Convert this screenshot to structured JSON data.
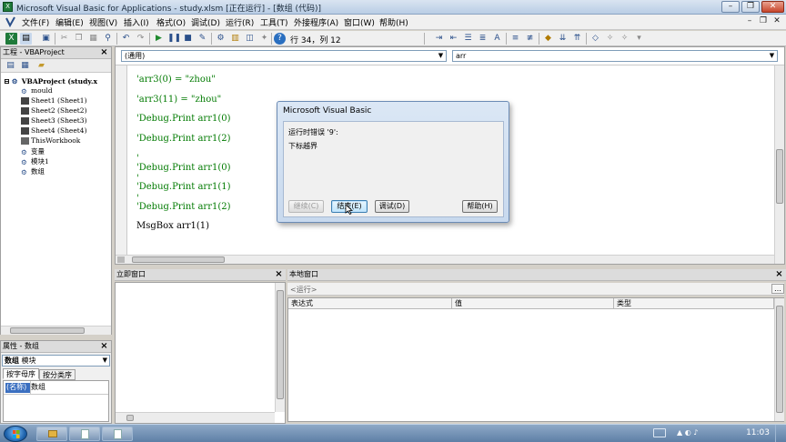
{
  "window": {
    "title": "Microsoft Visual Basic for Applications - study.xlsm [正在运行] - [数组 (代码)]"
  },
  "menu": {
    "items": [
      "文件(F)",
      "编辑(E)",
      "视图(V)",
      "插入(I)",
      "格式(O)",
      "调试(D)",
      "运行(R)",
      "工具(T)",
      "外接程序(A)",
      "窗口(W)",
      "帮助(H)"
    ]
  },
  "toolbar": {
    "position": "行 34，列 12"
  },
  "project": {
    "title": "工程 - VBAProject",
    "root": "VBAProject (study.x",
    "items": [
      "mould",
      "Sheet1 (Sheet1)",
      "Sheet2 (Sheet2)",
      "Sheet3 (Sheet3)",
      "Sheet4 (Sheet4)",
      "ThisWorkbook",
      "变量",
      "模块1",
      "数组"
    ]
  },
  "properties": {
    "title": "属性 - 数组",
    "object_name": "数组",
    "object_type": "模块",
    "tab_alpha": "按字母序",
    "tab_category": "按分类序",
    "row_name": "(名称)",
    "row_value": "数组"
  },
  "code": {
    "object_combo": "(通用)",
    "proc_combo": "arr",
    "lines": [
      {
        "text": "'arr3(0) = \"zhou\"",
        "type": "comment"
      },
      {
        "text": "'arr3(11) = \"zhou\"",
        "type": "comment"
      },
      {
        "text": "'Debug.Print arr1(0)",
        "type": "comment"
      },
      {
        "text": "'Debug.Print arr1(2)",
        "type": "comment"
      },
      {
        "text": "'",
        "type": "comment"
      },
      {
        "text": "'Debug.Print arr1(0)",
        "type": "comment"
      },
      {
        "text": "'",
        "type": "comment"
      },
      {
        "text": "'Debug.Print arr1(1)",
        "type": "comment"
      },
      {
        "text": "'",
        "type": "comment"
      },
      {
        "text": "'Debug.Print arr1(2)",
        "type": "comment"
      },
      {
        "text": "MsgBox arr1(1)",
        "type": "code"
      }
    ]
  },
  "dialog": {
    "title": "Microsoft Visual Basic",
    "message_line1": "运行时错误 '9':",
    "message_line2": "下标越界",
    "btn_continue": "继续(C)",
    "btn_end": "结束(E)",
    "btn_debug": "调试(D)",
    "btn_help": "帮助(H)"
  },
  "immediate": {
    "title": "立即窗口"
  },
  "locals": {
    "title": "本地窗口",
    "context": "<运行>",
    "col_expression": "表达式",
    "col_value": "值",
    "col_type": "类型"
  },
  "taskbar": {
    "clock": "11:03"
  },
  "colors": {
    "comment": "#007a00",
    "code": "#000000",
    "titlebar": "#c9d9ec"
  }
}
